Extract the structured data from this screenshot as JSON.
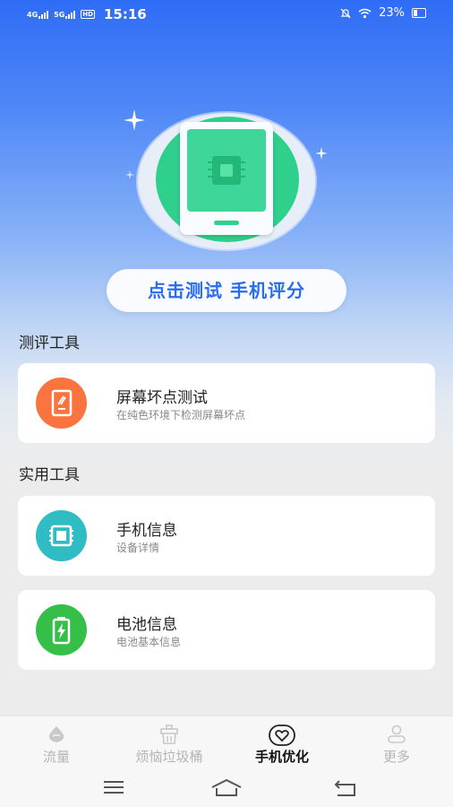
{
  "status_bar": {
    "network1": "4G",
    "network2": "5G",
    "hd": "HD",
    "time": "15:16",
    "battery": "23%",
    "icons": [
      "mute-icon",
      "wifi-icon",
      "battery-icon"
    ]
  },
  "hero": {
    "icon": "phone-chip-illustration",
    "cta_label": "点击测试 手机评分"
  },
  "sections": [
    {
      "title": "测评工具",
      "items": [
        {
          "title": "屏幕坏点测试",
          "subtitle": "在纯色环境下检测屏幕坏点",
          "icon": "screen-test-icon",
          "color": "#fa7440"
        }
      ]
    },
    {
      "title": "实用工具",
      "items": [
        {
          "title": "手机信息",
          "subtitle": "设备详情",
          "icon": "chip-icon",
          "color": "#2fbcc2"
        },
        {
          "title": "电池信息",
          "subtitle": "电池基本信息",
          "icon": "battery-charge-icon",
          "color": "#35bf49"
        }
      ]
    }
  ],
  "tabs": [
    {
      "label": "流量",
      "icon": "traffic-icon",
      "active": false
    },
    {
      "label": "烦恼垃圾桶",
      "icon": "trash-icon",
      "active": false
    },
    {
      "label": "手机优化",
      "icon": "heart-icon",
      "active": true
    },
    {
      "label": "更多",
      "icon": "user-icon",
      "active": false
    }
  ],
  "colors": {
    "accent": "#2a6cf0",
    "hero_green": "#2fcf8c"
  }
}
